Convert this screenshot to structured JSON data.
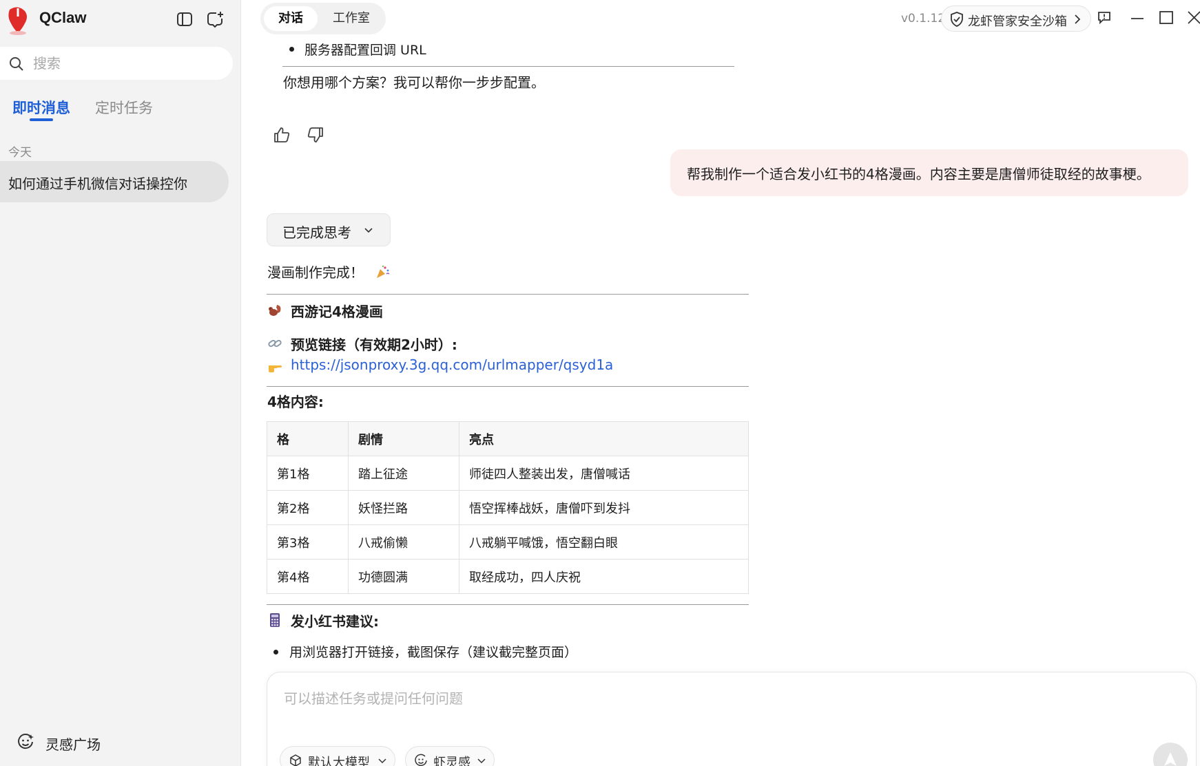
{
  "app": {
    "name": "QClaw",
    "version": "v0.1.12"
  },
  "sidebar": {
    "search_placeholder": "搜索",
    "tabs": [
      {
        "label": "即时消息",
        "active": true
      },
      {
        "label": "定时任务",
        "active": false
      }
    ],
    "group_label": "今天",
    "conversations": [
      {
        "title": "如何通过手机微信对话操控你",
        "selected": true
      }
    ],
    "footer_label": "灵感广场"
  },
  "topbar": {
    "mode_tabs": [
      {
        "label": "对话",
        "active": true
      },
      {
        "label": "工作室",
        "active": false
      }
    ],
    "sandbox_label": "龙虾管家安全沙箱"
  },
  "chat": {
    "previous": {
      "bullet": "服务器配置回调 URL",
      "question": "你想用哪个方案？我可以帮你一步步配置。"
    },
    "user_message": "帮我制作一个适合发小红书的4格漫画。内容主要是唐僧师徒取经的故事梗。",
    "thinking_label": "已完成思考",
    "reply": {
      "done_line": "漫画制作完成！",
      "comic_title": "西游记4格漫画",
      "preview_label": "预览链接（有效期2小时）:",
      "preview_link": "https://jsonproxy.3g.qq.com/urlmapper/qsyd1a",
      "content_heading": "4格内容:",
      "table": {
        "headers": [
          "格",
          "剧情",
          "亮点"
        ],
        "rows": [
          [
            "第1格",
            "踏上征途",
            "师徒四人整装出发，唐僧喊话"
          ],
          [
            "第2格",
            "妖怪拦路",
            "悟空挥棒战妖，唐僧吓到发抖"
          ],
          [
            "第3格",
            "八戒偷懒",
            "八戒躺平喊饿，悟空翻白眼"
          ],
          [
            "第4格",
            "功德圆满",
            "取经成功，四人庆祝"
          ]
        ]
      },
      "tips_heading": "发小红书建议:",
      "tips": [
        "用浏览器打开链接，截图保存（建议截完整页面）"
      ]
    }
  },
  "composer": {
    "placeholder": "可以描述任务或提问任何问题",
    "model_label": "默认大模型",
    "lingan_label": "虾灵感"
  },
  "colors": {
    "accent": "#1e5fd8",
    "link": "#2a60d6",
    "user_bubble": "#fdeeee",
    "sidebar_bg": "#f3f3f3"
  },
  "icons": [
    "claw-logo-icon",
    "sidebar-toggle-icon",
    "new-chat-icon",
    "search-icon",
    "thumbs-up-icon",
    "thumbs-down-icon",
    "chevron-down-icon",
    "squirrel-emoji-icon",
    "link-emoji-icon",
    "pointing-hand-emoji-icon",
    "calculator-emoji-icon",
    "party-popper-emoji-icon",
    "shield-icon",
    "feedback-icon",
    "minimize-icon",
    "maximize-icon",
    "close-icon",
    "cube-icon",
    "smile-icon",
    "send-arrow-icon"
  ]
}
